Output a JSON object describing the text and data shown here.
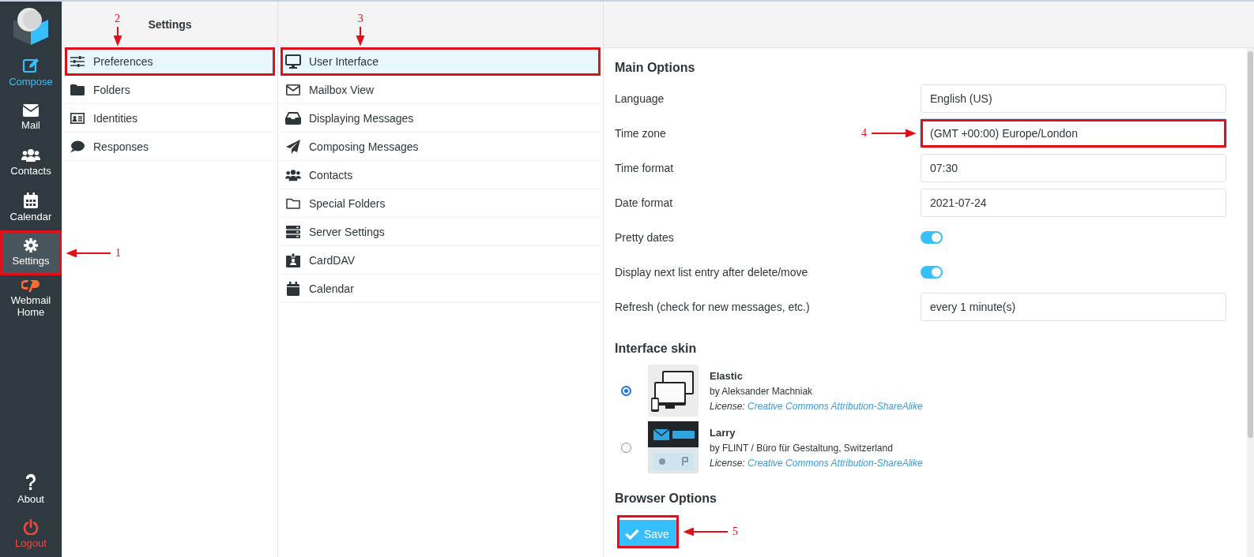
{
  "nav": {
    "items": [
      {
        "label": "Compose",
        "color": "#37beff",
        "selected": false
      },
      {
        "label": "Mail",
        "color": "#ffffff",
        "selected": false
      },
      {
        "label": "Contacts",
        "color": "#ffffff",
        "selected": false
      },
      {
        "label": "Calendar",
        "color": "#ffffff",
        "selected": false
      },
      {
        "label": "Settings",
        "color": "#ffffff",
        "selected": true,
        "callout": {
          "label": "1",
          "kind": "left"
        }
      },
      {
        "label": "Webmail Home",
        "color": "#ffffff",
        "selected": false
      }
    ],
    "bottom_items": [
      {
        "label": "About",
        "color": "#ffffff",
        "selected": false
      },
      {
        "label": "Logout",
        "color": "#f0483e",
        "selected": false
      }
    ]
  },
  "settings_menu": {
    "title": "Settings",
    "items": [
      {
        "label": "Preferences",
        "selected": true,
        "callout": {
          "label": "2",
          "kind": "down"
        }
      },
      {
        "label": "Folders",
        "selected": false
      },
      {
        "label": "Identities",
        "selected": false
      },
      {
        "label": "Responses",
        "selected": false
      }
    ]
  },
  "sections": {
    "items": [
      {
        "label": "User Interface",
        "selected": true,
        "callout": {
          "label": "3",
          "kind": "down"
        }
      },
      {
        "label": "Mailbox View",
        "selected": false
      },
      {
        "label": "Displaying Messages",
        "selected": false
      },
      {
        "label": "Composing Messages",
        "selected": false
      },
      {
        "label": "Contacts",
        "selected": false
      },
      {
        "label": "Special Folders",
        "selected": false
      },
      {
        "label": "Server Settings",
        "selected": false
      },
      {
        "label": "CardDAV",
        "selected": false
      },
      {
        "label": "Calendar",
        "selected": false
      }
    ]
  },
  "main": {
    "heading": "Main Options",
    "rows": [
      {
        "kind": "field",
        "label": "Language",
        "value": "English (US)",
        "focused": false
      },
      {
        "kind": "field",
        "label": "Time zone",
        "value": "(GMT +00:00) Europe/London",
        "focused": true,
        "callout": {
          "label": "4",
          "kind": "right"
        }
      },
      {
        "kind": "field",
        "label": "Time format",
        "value": "07:30",
        "focused": false
      },
      {
        "kind": "field",
        "label": "Date format",
        "value": "2021-07-24",
        "focused": false
      },
      {
        "kind": "toggle",
        "label": "Pretty dates",
        "on": true
      },
      {
        "kind": "toggle",
        "label": "Display next list entry after delete/move",
        "on": true
      },
      {
        "kind": "field",
        "label": "Refresh (check for new messages, etc.)",
        "value": "every 1 minute(s)",
        "focused": false
      }
    ],
    "skin_heading": "Interface skin",
    "skins": [
      {
        "kind": "elastic",
        "name": "Elastic",
        "author": "by Aleksander Machniak",
        "license_label": "License:",
        "license": "Creative Commons Attribution-ShareAlike",
        "selected": true
      },
      {
        "kind": "larry",
        "name": "Larry",
        "author": "by FLINT / Büro für Gestaltung, Switzerland",
        "license_label": "License:",
        "license": "Creative Commons Attribution-ShareAlike",
        "selected": false
      }
    ],
    "browser_heading": "Browser Options",
    "save": {
      "label": "Save",
      "callout": {
        "label": "5",
        "kind": "left"
      }
    }
  }
}
